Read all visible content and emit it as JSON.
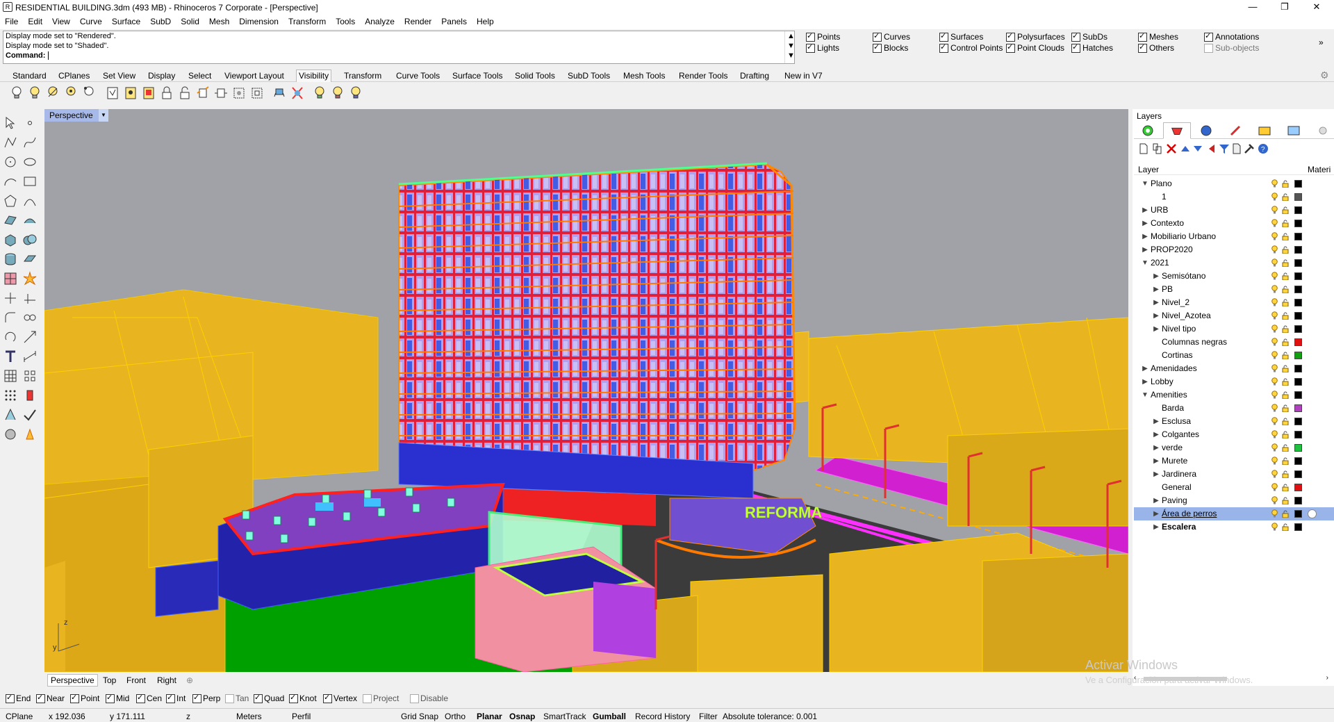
{
  "window": {
    "title": "RESIDENTIAL BUILDING.3dm (493 MB) - Rhinoceros 7 Corporate - [Perspective]",
    "minimize": "—",
    "restore": "❐",
    "close": "✕"
  },
  "menu": [
    "File",
    "Edit",
    "View",
    "Curve",
    "Surface",
    "SubD",
    "Solid",
    "Mesh",
    "Dimension",
    "Transform",
    "Tools",
    "Analyze",
    "Render",
    "Panels",
    "Help"
  ],
  "command": {
    "history": [
      "Display mode set to \"Rendered\".",
      "Display mode set to \"Shaded\"."
    ],
    "prompt": "Command:"
  },
  "filters": [
    {
      "label": "Points",
      "checked": true
    },
    {
      "label": "Lights",
      "checked": true
    },
    {
      "label": "Curves",
      "checked": true
    },
    {
      "label": "Blocks",
      "checked": true
    },
    {
      "label": "Surfaces",
      "checked": true
    },
    {
      "label": "Control Points",
      "checked": true
    },
    {
      "label": "Polysurfaces",
      "checked": true
    },
    {
      "label": "Point Clouds",
      "checked": true
    },
    {
      "label": "SubDs",
      "checked": true
    },
    {
      "label": "Hatches",
      "checked": true
    },
    {
      "label": "Meshes",
      "checked": true
    },
    {
      "label": "Others",
      "checked": true
    },
    {
      "label": "Annotations",
      "checked": true
    },
    {
      "label": "Sub-objects",
      "checked": false
    }
  ],
  "toolbar_tabs": [
    "Standard",
    "CPlanes",
    "Set View",
    "Display",
    "Select",
    "Viewport Layout",
    "Visibility",
    "Transform",
    "Curve Tools",
    "Surface Tools",
    "Solid Tools",
    "SubD Tools",
    "Mesh Tools",
    "Render Tools",
    "Drafting",
    "New in V7"
  ],
  "active_tab": "Visibility",
  "viewport": {
    "name": "Perspective",
    "dropdown": "▼",
    "sign_text": "REFORMA",
    "axis_z": "z",
    "axis_y": "y"
  },
  "viewport_tabs": [
    "Perspective",
    "Top",
    "Front",
    "Right"
  ],
  "viewport_tab_add": "⊕",
  "osnaps": [
    {
      "label": "End",
      "checked": true
    },
    {
      "label": "Near",
      "checked": true
    },
    {
      "label": "Point",
      "checked": true
    },
    {
      "label": "Mid",
      "checked": true
    },
    {
      "label": "Cen",
      "checked": true
    },
    {
      "label": "Int",
      "checked": true
    },
    {
      "label": "Perp",
      "checked": true
    },
    {
      "label": "Tan",
      "checked": false
    },
    {
      "label": "Quad",
      "checked": true
    },
    {
      "label": "Knot",
      "checked": true
    },
    {
      "label": "Vertex",
      "checked": true
    },
    {
      "label": "Project",
      "checked": false
    },
    {
      "label": "Disable",
      "checked": false
    }
  ],
  "status": {
    "cplane": "CPlane",
    "x": "x 192.036",
    "y": "y 171.111",
    "z": "z",
    "units": "Meters",
    "layer": "Perfil",
    "grid_snap": "Grid Snap",
    "ortho": "Ortho",
    "planar": "Planar",
    "osnap": "Osnap",
    "smarttrack": "SmartTrack",
    "gumball": "Gumball",
    "record_history": "Record History",
    "filter": "Filter",
    "tolerance": "Absolute tolerance: 0.001"
  },
  "panel": {
    "title": "Layers",
    "col_layer": "Layer",
    "col_material": "Materi",
    "layers": [
      {
        "name": "Plano",
        "level": 0,
        "exp": "▼",
        "color": "#000000"
      },
      {
        "name": "1",
        "level": 1,
        "exp": "",
        "color": "#555555"
      },
      {
        "name": "URB",
        "level": 0,
        "exp": "▶",
        "color": "#000000"
      },
      {
        "name": "Contexto",
        "level": 0,
        "exp": "▶",
        "color": "#000000"
      },
      {
        "name": "Mobiliario Urbano",
        "level": 0,
        "exp": "▶",
        "color": "#000000"
      },
      {
        "name": "PROP2020",
        "level": 0,
        "exp": "▶",
        "color": "#000000"
      },
      {
        "name": "2021",
        "level": 0,
        "exp": "▼",
        "color": "#000000"
      },
      {
        "name": "Semisótano",
        "level": 1,
        "exp": "▶",
        "color": "#000000"
      },
      {
        "name": "PB",
        "level": 1,
        "exp": "▶",
        "color": "#000000"
      },
      {
        "name": "Nivel_2",
        "level": 1,
        "exp": "▶",
        "color": "#000000"
      },
      {
        "name": "Nivel_Azotea",
        "level": 1,
        "exp": "▶",
        "color": "#000000"
      },
      {
        "name": "Nivel tipo",
        "level": 1,
        "exp": "▶",
        "color": "#000000"
      },
      {
        "name": "Columnas negras",
        "level": 1,
        "exp": "",
        "color": "#e01010"
      },
      {
        "name": "Cortinas",
        "level": 1,
        "exp": "",
        "color": "#10a010"
      },
      {
        "name": "Amenidades",
        "level": 0,
        "exp": "▶",
        "color": "#000000"
      },
      {
        "name": "Lobby",
        "level": 0,
        "exp": "▶",
        "color": "#000000"
      },
      {
        "name": "Amenities",
        "level": 0,
        "exp": "▼",
        "color": "#000000"
      },
      {
        "name": "Barda",
        "level": 1,
        "exp": "",
        "color": "#b040c0"
      },
      {
        "name": "Esclusa",
        "level": 1,
        "exp": "▶",
        "color": "#000000"
      },
      {
        "name": "Colgantes",
        "level": 1,
        "exp": "▶",
        "color": "#000000"
      },
      {
        "name": "verde",
        "level": 1,
        "exp": "▶",
        "color": "#20c040"
      },
      {
        "name": "Murete",
        "level": 1,
        "exp": "▶",
        "color": "#000000"
      },
      {
        "name": "Jardinera",
        "level": 1,
        "exp": "▶",
        "color": "#000000"
      },
      {
        "name": "General",
        "level": 1,
        "exp": "",
        "color": "#e01010"
      },
      {
        "name": "Paving",
        "level": 1,
        "exp": "▶",
        "color": "#000000"
      },
      {
        "name": "Área de perros",
        "level": 1,
        "exp": "▶",
        "color": "#000000",
        "selected": true
      },
      {
        "name": "Escalera",
        "level": 1,
        "exp": "▶",
        "color": "#000000",
        "bold": true
      }
    ]
  },
  "watermark": {
    "line1": "Activar Windows",
    "line2": "Ve a Configuración para activar Windows."
  },
  "colors": {
    "context": "#e8b420",
    "facade_red": "#e0203a",
    "glass": "#8888ee",
    "ground": "#00aa00",
    "road": "#3a3a3a",
    "magenta": "#ff00ff",
    "blue_block": "#2020b0"
  }
}
